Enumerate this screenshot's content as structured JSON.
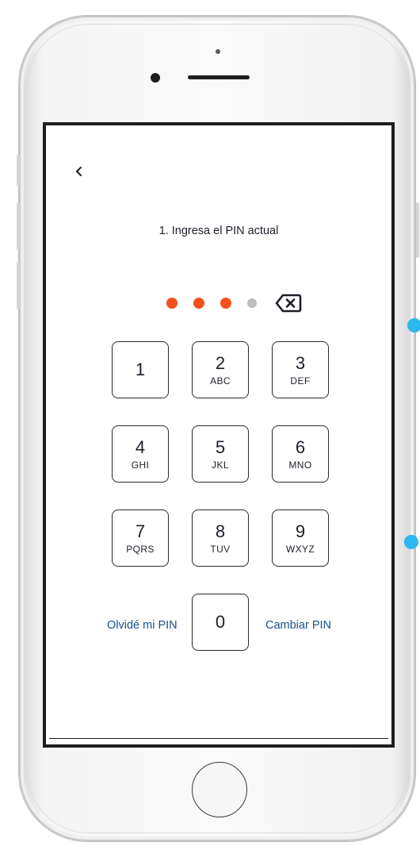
{
  "screen": {
    "title": "1. Ingresa el PIN actual",
    "pin": {
      "length": 4,
      "entered": 3,
      "filled_color": "#f4511e",
      "empty_color": "#bdbdbd"
    },
    "keys": [
      {
        "digit": "1",
        "letters": ""
      },
      {
        "digit": "2",
        "letters": "ABC"
      },
      {
        "digit": "3",
        "letters": "DEF"
      },
      {
        "digit": "4",
        "letters": "GHI"
      },
      {
        "digit": "5",
        "letters": "JKL"
      },
      {
        "digit": "6",
        "letters": "MNO"
      },
      {
        "digit": "7",
        "letters": "PQRS"
      },
      {
        "digit": "8",
        "letters": "TUV"
      },
      {
        "digit": "9",
        "letters": "WXYZ"
      },
      {
        "digit": "0",
        "letters": ""
      }
    ],
    "links": {
      "forgot_pin": "Olvidé mi PIN",
      "change_pin": "Cambiar PIN"
    },
    "link_color": "#1c4e8c"
  },
  "icons": {
    "back": "chevron-left-icon",
    "backspace": "backspace-icon"
  },
  "accent_colors": {
    "pin_filled": "#f4511e",
    "annotation_dot": "#2bb8f0"
  }
}
